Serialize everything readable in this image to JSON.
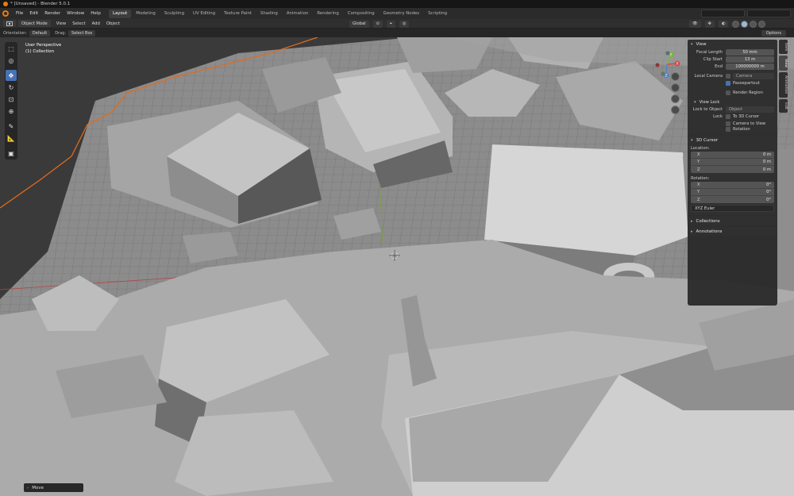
{
  "window": {
    "title": "* [Unsaved] - Blender 5.0.1"
  },
  "menu": {
    "items": [
      "File",
      "Edit",
      "Render",
      "Window",
      "Help"
    ]
  },
  "workspaces": [
    "Layout",
    "Modeling",
    "Sculpting",
    "UV Editing",
    "Texture Paint",
    "Shading",
    "Animation",
    "Rendering",
    "Compositing",
    "Geometry Nodes",
    "Scripting"
  ],
  "active_workspace": "Layout",
  "header": {
    "mode": "Object Mode",
    "menus": [
      "View",
      "Select",
      "Add",
      "Object"
    ],
    "transform_orientation": "Global"
  },
  "tool_settings": {
    "orientation_label": "Orientation:",
    "orientation_value": "Default",
    "drag_label": "Drag:",
    "drag_value": "Select Box",
    "options_label": "Options"
  },
  "viewport": {
    "perspective": "User Perspective",
    "collection": "(1) Collection"
  },
  "npanel": {
    "view_section": "View",
    "focal_length_label": "Focal Length",
    "focal_length_value": "50 mm",
    "clip_start_label": "Clip Start",
    "clip_start_value": "13 m",
    "clip_end_label": "End",
    "clip_end_value": "100000000 m",
    "local_camera_label": "Local Camera",
    "local_camera_value": "Camera",
    "passepartout_label": "Passepartout",
    "render_region_label": "Render Region",
    "view_lock_section": "View Lock",
    "lock_to_object_label": "Lock to Object",
    "lock_to_object_placeholder": "Object",
    "lock_label": "Lock",
    "to_3d_cursor_label": "To 3D Cursor",
    "camera_to_view_label": "Camera to View",
    "rotation_lock_label": "Rotation",
    "cursor_section": "3D Cursor",
    "location_label": "Location:",
    "loc_x": "0 m",
    "loc_y": "0 m",
    "loc_z": "0 m",
    "rotation_label": "Rotation:",
    "rot_x": "0°",
    "rot_y": "0°",
    "rot_z": "0°",
    "rotation_mode": "XYZ Euler",
    "collections_section": "Collections",
    "annotations_section": "Annotations"
  },
  "axis_labels": {
    "x": "X",
    "y": "Y",
    "z": "Z"
  },
  "side_tabs": [
    "Item",
    "View",
    "Animation",
    "Edit"
  ],
  "last_operator": "Move"
}
